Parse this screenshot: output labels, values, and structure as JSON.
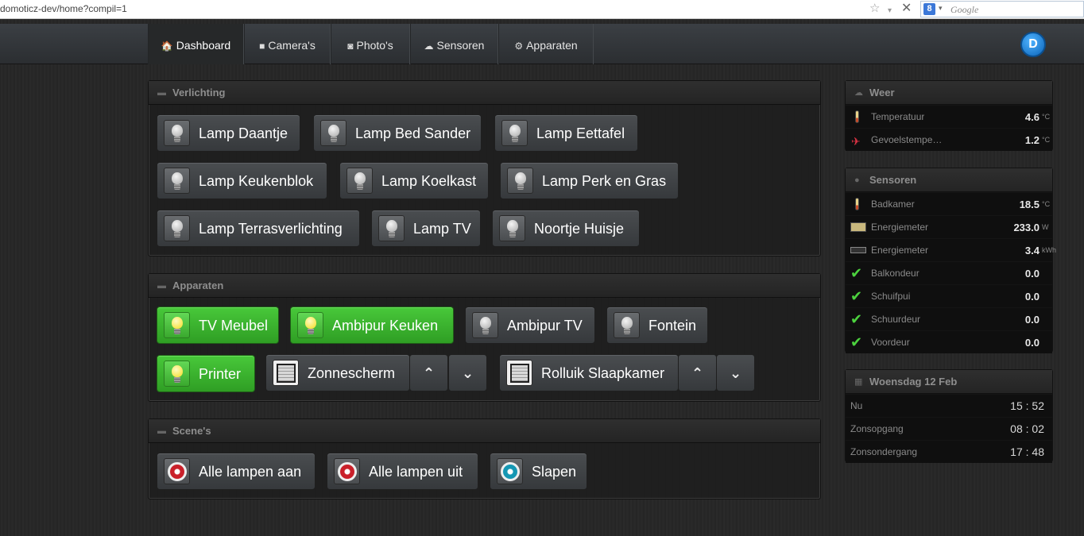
{
  "browser": {
    "url": "domoticz-dev/home?compil=1",
    "search_placeholder": "Google",
    "star_icon": "☆",
    "down_icon": "▾",
    "close_icon": "✕",
    "search_logo": "8"
  },
  "nav": {
    "items": [
      {
        "label": "Dashboard",
        "icon": "🏠"
      },
      {
        "label": "Camera's",
        "icon": "■"
      },
      {
        "label": "Photo's",
        "icon": "◙"
      },
      {
        "label": "Sensoren",
        "icon": "☁"
      },
      {
        "label": "Apparaten",
        "icon": "⚙"
      }
    ],
    "logo": "D"
  },
  "verlichting": {
    "title": "Verlichting",
    "devices": [
      "Lamp Daantje",
      "Lamp Bed Sander",
      "Lamp Eettafel",
      "Lamp Keukenblok",
      "Lamp Koelkast",
      "Lamp Perk en Gras",
      "Lamp Terrasverlichting",
      "Lamp TV",
      "Noortje Huisje"
    ]
  },
  "apparaten": {
    "title": "Apparaten",
    "devices": [
      "TV Meubel",
      "Ambipur Keuken",
      "Ambipur TV",
      "Fontein",
      "Printer"
    ],
    "blinds": [
      "Zonnescherm",
      "Rolluik Slaapkamer"
    ],
    "up_arrow": "⌃",
    "down_arrow": "⌄"
  },
  "scenes": {
    "title": "Scene's",
    "items": [
      "Alle lampen aan",
      "Alle lampen uit",
      "Slapen"
    ]
  },
  "weer": {
    "title": "Weer",
    "rows": [
      {
        "label": "Temperatuur",
        "value": "4.6",
        "unit": "°C"
      },
      {
        "label": "Gevoelstemperatuur",
        "value": "1.2",
        "unit": "°C"
      }
    ]
  },
  "sensoren": {
    "title": "Sensoren",
    "rows": [
      {
        "label": "Badkamer",
        "value": "18.5",
        "unit": "°C"
      },
      {
        "label": "Energiemeter",
        "value": "233.0",
        "unit": "W"
      },
      {
        "label": "Energiemeter",
        "value": "3.4",
        "unit": "kWh"
      },
      {
        "label": "Balkondeur",
        "value": "0.0",
        "unit": ""
      },
      {
        "label": "Schuifpui",
        "value": "0.0",
        "unit": ""
      },
      {
        "label": "Schuurdeur",
        "value": "0.0",
        "unit": ""
      },
      {
        "label": "Voordeur",
        "value": "0.0",
        "unit": ""
      }
    ]
  },
  "datum": {
    "title": "Woensdag 12 Feb",
    "rows": [
      {
        "label": "Nu",
        "value": "15 : 52"
      },
      {
        "label": "Zonsopgang",
        "value": "08 : 02"
      },
      {
        "label": "Zonsondergang",
        "value": "17 : 48"
      }
    ]
  },
  "icons": {
    "folder": "▬",
    "cloud": "☁",
    "info": "●",
    "calendar": "▦",
    "check": "✔",
    "wind": "✈"
  },
  "colors": {
    "on": "#3aa82e",
    "off": "#404346",
    "panel": "#1e1e1e"
  }
}
